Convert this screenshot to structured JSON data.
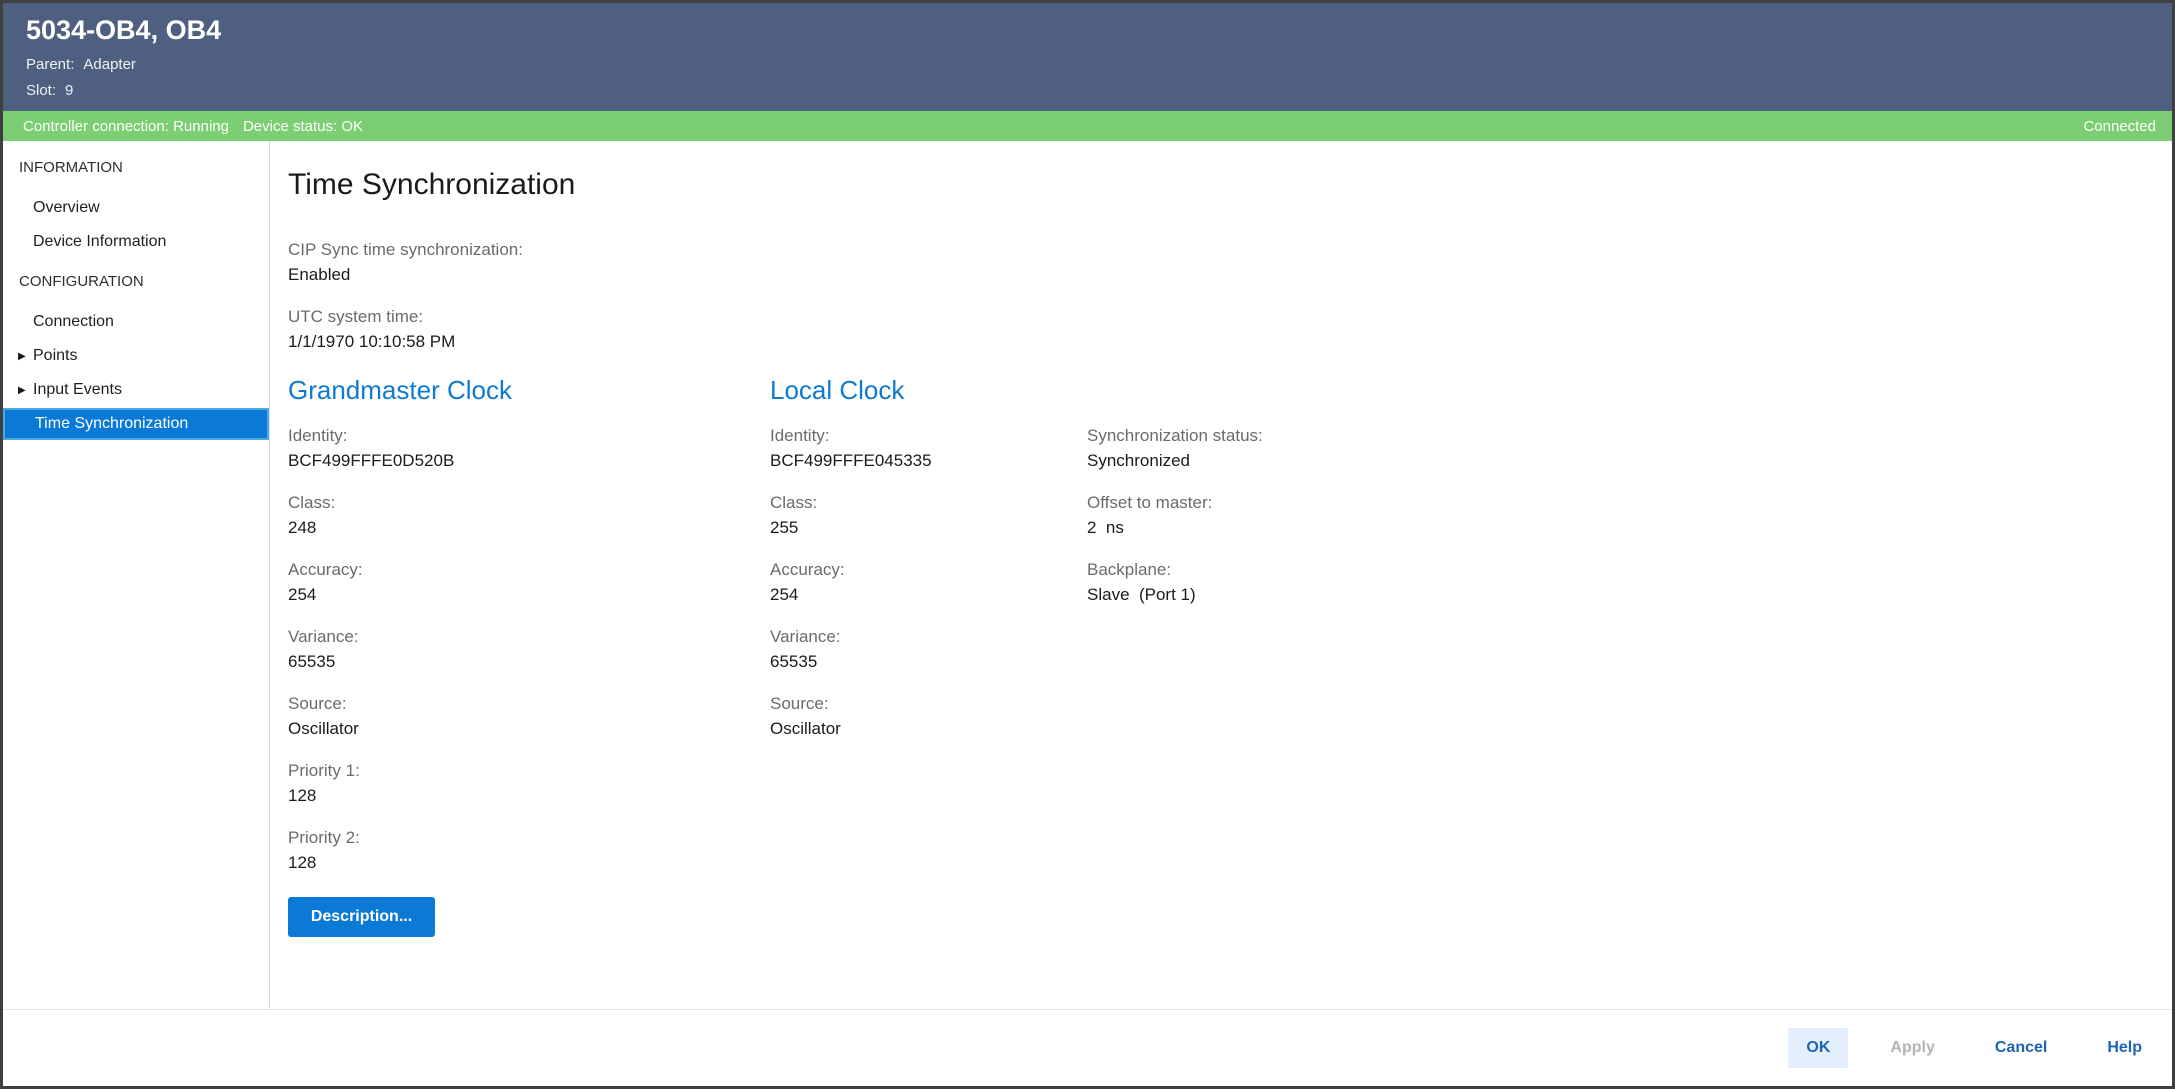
{
  "header": {
    "title": "5034-OB4, OB4",
    "parent": {
      "label": "Parent:",
      "value": "Adapter"
    },
    "slot": {
      "label": "Slot:",
      "value": "9"
    }
  },
  "status_bar": {
    "controller": "Controller connection: Running",
    "device": "Device status: OK",
    "connection": "Connected"
  },
  "sidebar": {
    "sections": [
      {
        "header": "INFORMATION",
        "items": [
          {
            "label": "Overview"
          },
          {
            "label": "Device Information"
          }
        ]
      },
      {
        "header": "CONFIGURATION",
        "items": [
          {
            "label": "Connection"
          },
          {
            "label": "Points",
            "expandable": true
          },
          {
            "label": "Input Events",
            "expandable": true
          },
          {
            "label": "Time Synchronization",
            "selected": true
          }
        ]
      }
    ],
    "expand_icon": "▶"
  },
  "main": {
    "title": "Time Synchronization",
    "general_fields": [
      {
        "label": "CIP Sync time synchronization:",
        "value": "Enabled"
      },
      {
        "label": "UTC system time:",
        "value": "1/1/1970 10:10:58 PM"
      }
    ],
    "grandmaster": {
      "heading": "Grandmaster Clock",
      "fields": [
        {
          "label": "Identity:",
          "value": "BCF499FFFE0D520B"
        },
        {
          "label": "Class:",
          "value": "248"
        },
        {
          "label": "Accuracy:",
          "value": "254"
        },
        {
          "label": "Variance:",
          "value": "65535"
        },
        {
          "label": "Source:",
          "value": "Oscillator"
        },
        {
          "label": "Priority 1:",
          "value": "128"
        },
        {
          "label": "Priority 2:",
          "value": "128"
        }
      ],
      "description_button": "Description..."
    },
    "local_clock": {
      "heading": "Local Clock",
      "fields": [
        {
          "label": "Identity:",
          "value": "BCF499FFFE045335"
        },
        {
          "label": "Class:",
          "value": "255"
        },
        {
          "label": "Accuracy:",
          "value": "254"
        },
        {
          "label": "Variance:",
          "value": "65535"
        },
        {
          "label": "Source:",
          "value": "Oscillator"
        }
      ]
    },
    "sync_status": {
      "fields": [
        {
          "label": "Synchronization status:",
          "value": "Synchronized"
        },
        {
          "label": "Offset to master:",
          "value": "2  ns"
        },
        {
          "label": "Backplane:",
          "value": "Slave  (Port 1)"
        }
      ]
    }
  },
  "footer": {
    "ok": "OK",
    "apply": "Apply",
    "cancel": "Cancel",
    "help": "Help"
  },
  "colors": {
    "header_bg": "#4e5f7f",
    "status_bar_bg": "#7bce71",
    "selection_blue": "#0a7ad6",
    "section_heading_blue": "#0f7ad2",
    "footer_link_blue": "#1c64b6",
    "label_gray": "#6b6b6b"
  }
}
